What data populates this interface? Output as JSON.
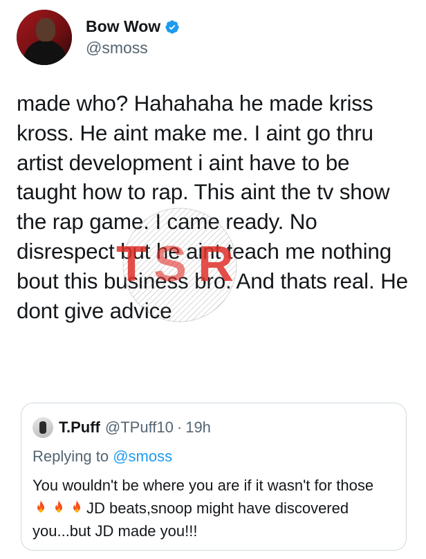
{
  "author": {
    "display_name": "Bow Wow",
    "handle": "@smoss",
    "verified": true,
    "verified_color": "#1d9bf0"
  },
  "tweet": {
    "text": "made who? Hahahaha he made kriss kross. He aint make me. I aint go thru artist development i aint have to be taught how to rap. This aint the tv show the rap game. I came ready. No disrespect but he aint teach me nothing bout this business bro. And thats real. He dont give advice"
  },
  "watermark": {
    "text": "TSR",
    "color": "#e0312b"
  },
  "quoted_tweet": {
    "display_name": "T.Puff",
    "handle": "@TPuff10",
    "separator": "·",
    "time": "19h",
    "replying_to_label": "Replying to",
    "replying_to_handle": "@smoss",
    "text_before": "You wouldn't be where you are if it wasn't for those",
    "emoji": [
      "fire-icon",
      "fire-icon",
      "fire-icon"
    ],
    "text_after": "JD beats,snoop might have discovered you...but JD made you!!!"
  },
  "colors": {
    "text_primary": "#14171a",
    "text_secondary": "#536471",
    "link": "#1d9bf0",
    "border": "#cfd9de"
  }
}
